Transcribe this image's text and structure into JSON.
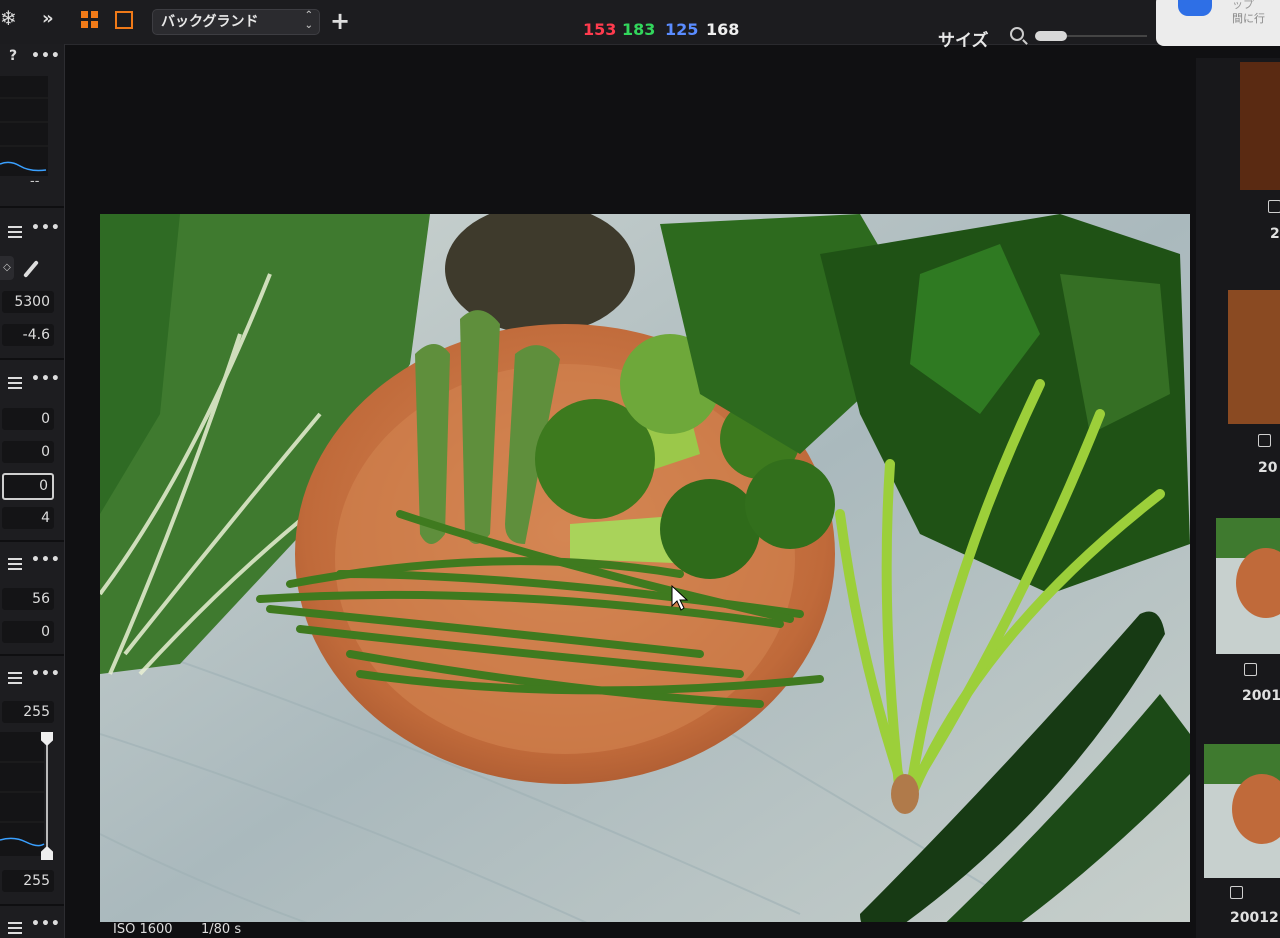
{
  "toolbar": {
    "background_select": "バックグランド",
    "rgb": {
      "r": "153",
      "g": "183",
      "b": "125",
      "lum": "168"
    },
    "size_label": "サイズ",
    "colors": {
      "accent": "#f07a18",
      "red": "#ff3b4e",
      "green": "#32d65c",
      "blue": "#5a8cff"
    }
  },
  "notification": {
    "line1": "ップ",
    "line2": "間に行"
  },
  "left_panel": {
    "help": "?",
    "menu": "•••",
    "histogram_value": "--",
    "white_balance": {
      "temperature": "5300",
      "tint": "-4.6"
    },
    "exposure": {
      "values": [
        "0",
        "0",
        "0",
        "4"
      ]
    },
    "clarity": {
      "values": [
        "56",
        "0"
      ]
    },
    "levels": {
      "high": "255",
      "low": "255"
    }
  },
  "filmstrip": {
    "items": [
      {
        "label": "2"
      },
      {
        "label": "20"
      },
      {
        "label": "2001"
      },
      {
        "label": "20012"
      }
    ]
  },
  "status": {
    "iso": "ISO 1600",
    "shutter": "1/80 s"
  }
}
